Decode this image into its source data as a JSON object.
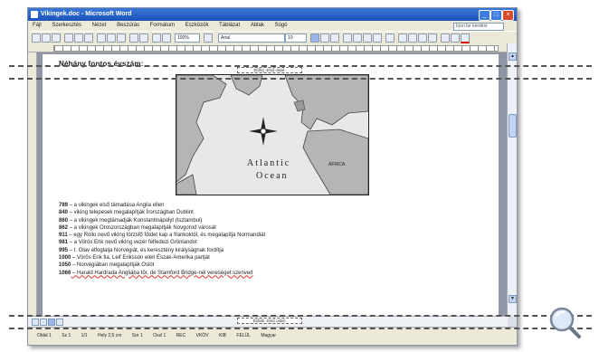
{
  "window": {
    "title": "Vikingek.doc - Microsoft Word"
  },
  "menu": [
    "Fájl",
    "Szerkesztés",
    "Nézet",
    "Beszúrás",
    "Formátum",
    "Eszközök",
    "Táblázat",
    "Ablak",
    "Súgó"
  ],
  "help_placeholder": "Írjon be kérdést",
  "toolbar": {
    "zoom": "100%",
    "style": "Arial",
    "size": "10"
  },
  "header_label": "Élőfej -Első oldal-",
  "footer_label": "Élőláb -Első oldal-",
  "heading": "Néhány fontos évszám:",
  "map": {
    "label_atlantic": "Atlantic",
    "label_ocean": "Ocean",
    "label_africa": "AFRICA"
  },
  "entries": [
    {
      "year": "789",
      "text": " – a vikingek első támadása Anglia ellen"
    },
    {
      "year": "840",
      "text": " – viking telepesek megalapítják Írországban Dublint"
    },
    {
      "year": "860",
      "text": " – a vikingek megtámadják Konstantinápolyt (Isztambul)"
    },
    {
      "year": "862",
      "text": " – a vikingek Oroszországban megalapítják Novgorod városát"
    },
    {
      "year": "911",
      "text": " – egy Rollo nevű viking törzsfő földet kap a frankoktól, és megalapítja Normandiát"
    },
    {
      "year": "981",
      "text": " – a Vörös Erik nevű viking vezér felfedezi Grönlandot"
    },
    {
      "year": "995",
      "text": " – I. Olav elfoglalja Norvégiát, és keresztény királyságnak fordítja"
    },
    {
      "year": "1000",
      "text": " – Vörös Erik fia, Leif Eriksson eléri Észak-Amerika partját"
    },
    {
      "year": "1050",
      "text": " – Norvégiában megalapítják Oslót"
    },
    {
      "year": "1066",
      "text": " – Harald Hardrada Angliába tör, de Stamford Bridge-nél vereséget szenved"
    }
  ],
  "status": [
    "Oldal 1",
    "Sz 1",
    "1/1",
    "Hely 2,5 cm",
    "Sor 1",
    "Oszl 1",
    "REC",
    "VKÖV",
    "KIB",
    "FELÜL",
    "Magyar"
  ]
}
